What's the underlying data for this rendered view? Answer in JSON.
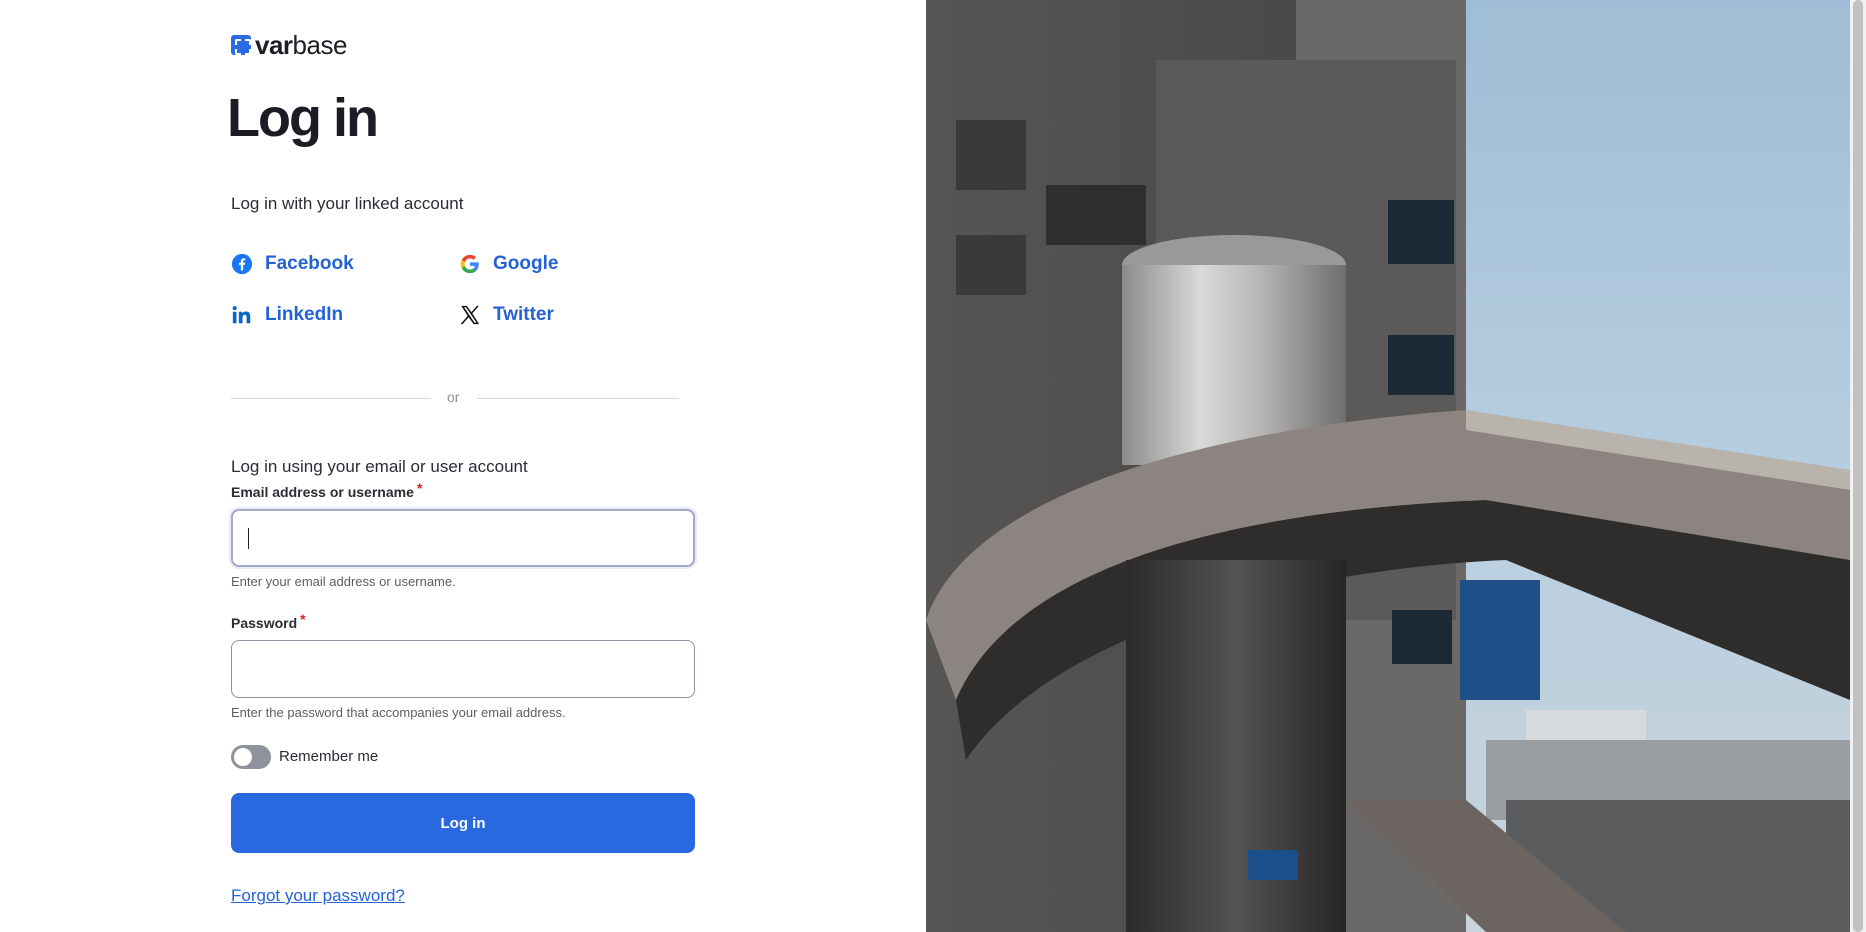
{
  "brand": {
    "name_bold": "var",
    "name_rest": "base"
  },
  "page": {
    "title": "Log in"
  },
  "linked": {
    "label": "Log in with your linked account",
    "providers": [
      {
        "name": "Facebook",
        "icon": "facebook-icon"
      },
      {
        "name": "Google",
        "icon": "google-icon"
      },
      {
        "name": "LinkedIn",
        "icon": "linkedin-icon"
      },
      {
        "name": "Twitter",
        "icon": "x-twitter-icon"
      }
    ]
  },
  "divider": {
    "text": "or"
  },
  "account": {
    "label": "Log in using your email or user account"
  },
  "form": {
    "email": {
      "label": "Email address or username",
      "required_mark": "*",
      "value": "",
      "help": "Enter your email address or username."
    },
    "password": {
      "label": "Password",
      "required_mark": "*",
      "value": "",
      "help": "Enter the password that accompanies your email address."
    },
    "remember": {
      "label": "Remember me",
      "checked": false
    },
    "submit_label": "Log in",
    "forgot_label": "Forgot your password?"
  },
  "colors": {
    "accent": "#2969e0",
    "link": "#2463d6",
    "required": "#d3222a"
  }
}
